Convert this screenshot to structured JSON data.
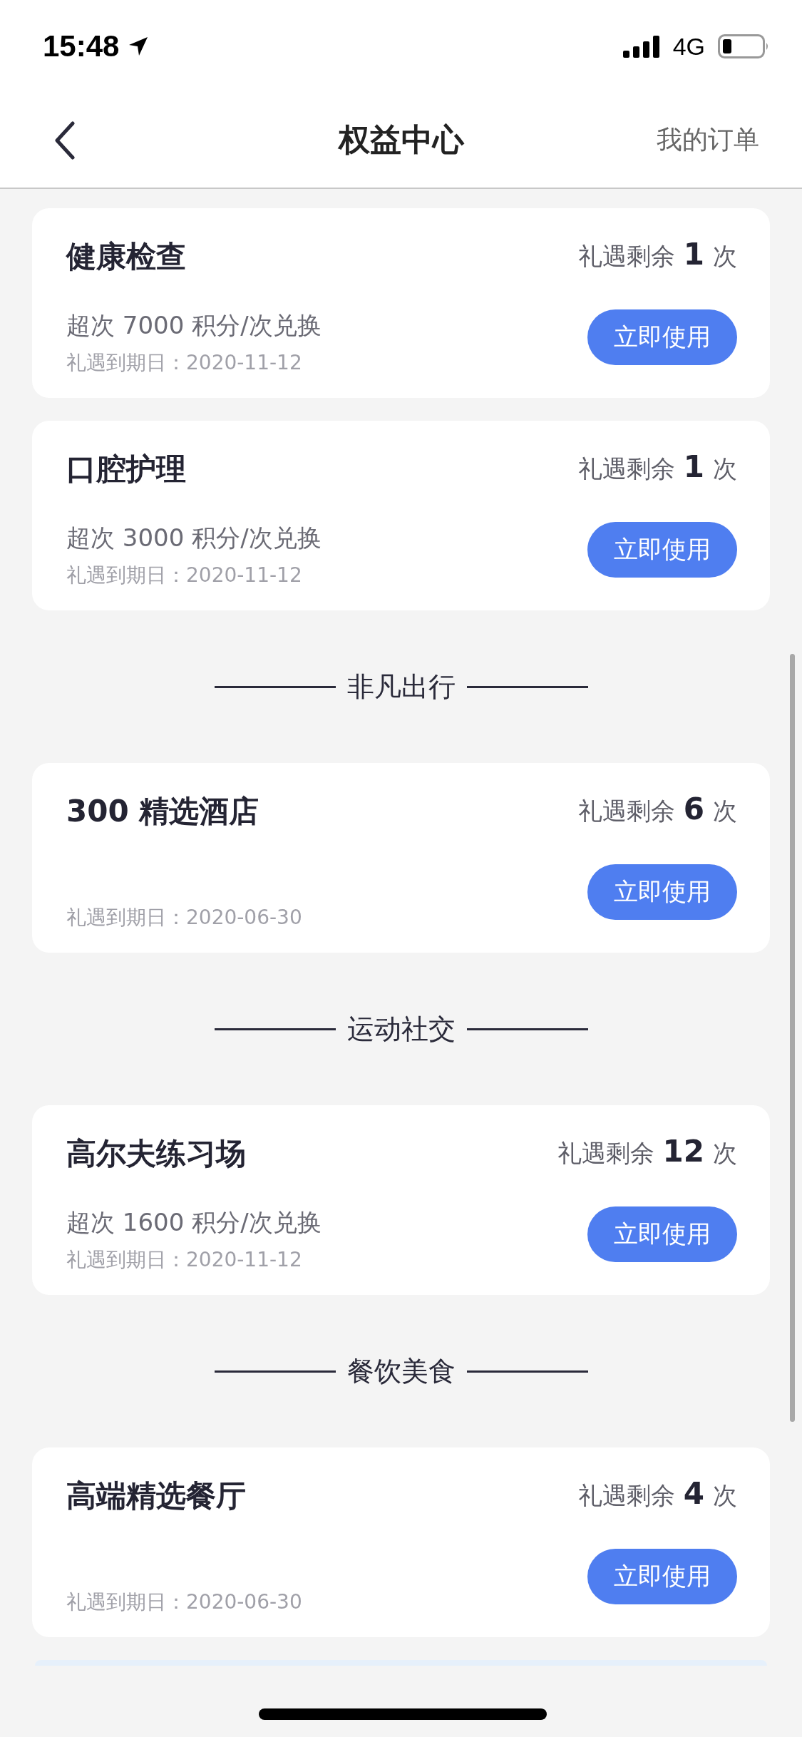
{
  "status_bar": {
    "time": "15:48",
    "network": "4G"
  },
  "nav": {
    "title": "权益中心",
    "action": "我的订单"
  },
  "sections": [
    {
      "cards": [
        {
          "title": "健康检查",
          "remaining_label": "礼遇剩余",
          "count": "1",
          "unit": "次",
          "note": "超次 7000 积分/次兑换",
          "expiry": "礼遇到期日：2020-11-12",
          "button": "立即使用"
        },
        {
          "title": "口腔护理",
          "remaining_label": "礼遇剩余",
          "count": "1",
          "unit": "次",
          "note": "超次 3000 积分/次兑换",
          "expiry": "礼遇到期日：2020-11-12",
          "button": "立即使用"
        }
      ]
    },
    {
      "header": "非凡出行",
      "cards": [
        {
          "title": "300 精选酒店",
          "remaining_label": "礼遇剩余",
          "count": "6",
          "unit": "次",
          "expiry": "礼遇到期日：2020-06-30",
          "button": "立即使用"
        }
      ]
    },
    {
      "header": "运动社交",
      "cards": [
        {
          "title": "高尔夫练习场",
          "remaining_label": "礼遇剩余",
          "count": "12",
          "unit": "次",
          "note": "超次 1600 积分/次兑换",
          "expiry": "礼遇到期日：2020-11-12",
          "button": "立即使用"
        }
      ]
    },
    {
      "header": "餐饮美食",
      "cards": [
        {
          "title": "高端精选餐厅",
          "remaining_label": "礼遇剩余",
          "count": "4",
          "unit": "次",
          "expiry": "礼遇到期日：2020-06-30",
          "button": "立即使用"
        }
      ]
    }
  ]
}
